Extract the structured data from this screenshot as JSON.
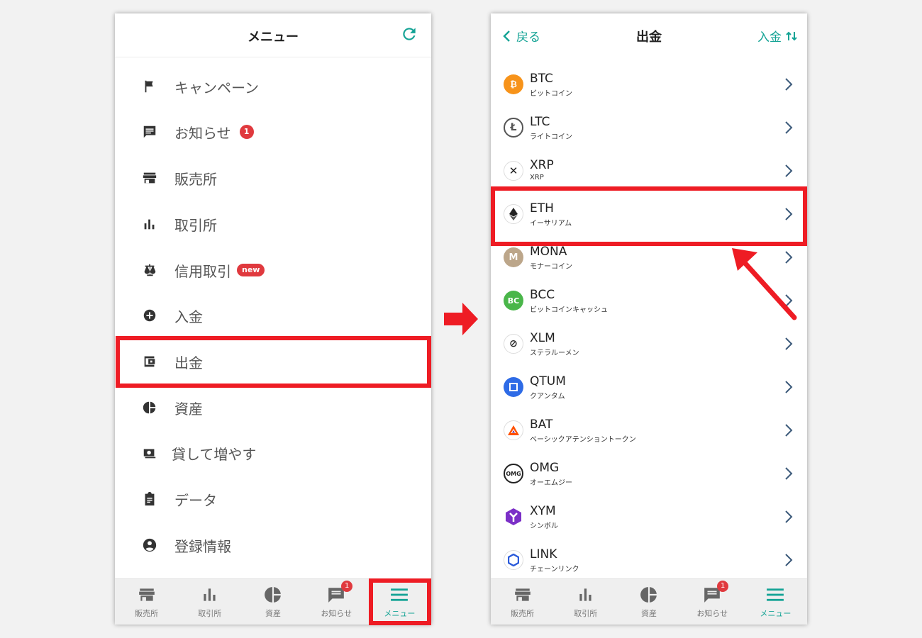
{
  "left": {
    "title": "メニュー",
    "refresh_icon": "refresh-icon",
    "items": [
      {
        "icon": "flag-icon",
        "label": "キャンペーン"
      },
      {
        "icon": "message-icon",
        "label": "お知らせ",
        "badge": "1"
      },
      {
        "icon": "store-icon",
        "label": "販売所"
      },
      {
        "icon": "bar-chart-icon",
        "label": "取引所"
      },
      {
        "icon": "scale-icon",
        "label": "信用取引",
        "tag": "new"
      },
      {
        "icon": "plus-circle-icon",
        "label": "入金"
      },
      {
        "icon": "wallet-icon",
        "label": "出金"
      },
      {
        "icon": "pie-chart-icon",
        "label": "資産"
      },
      {
        "icon": "money-icon",
        "label": "貸して増やす"
      },
      {
        "icon": "clipboard-icon",
        "label": "データ"
      },
      {
        "icon": "account-icon",
        "label": "登録情報"
      }
    ]
  },
  "tabs": [
    {
      "icon": "store-icon",
      "label": "販売所"
    },
    {
      "icon": "bar-chart-icon",
      "label": "取引所"
    },
    {
      "icon": "pie-chart-icon",
      "label": "資産"
    },
    {
      "icon": "message-icon",
      "label": "お知らせ",
      "badge": "1"
    },
    {
      "icon": "menu-icon",
      "label": "メニュー"
    }
  ],
  "right": {
    "back_label": "戻る",
    "title": "出金",
    "deposit_label": "入金",
    "coins": [
      {
        "symbol": "BTC",
        "name": "ビットコイン",
        "color": "#f7931a"
      },
      {
        "symbol": "LTC",
        "name": "ライトコイン",
        "color": "#ffffff"
      },
      {
        "symbol": "XRP",
        "name": "XRP",
        "color": "#ffffff"
      },
      {
        "symbol": "ETH",
        "name": "イーサリアム",
        "color": "#ffffff"
      },
      {
        "symbol": "MONA",
        "name": "モナーコイン",
        "color": "#bca68a"
      },
      {
        "symbol": "BCC",
        "name": "ビットコインキャッシュ",
        "color": "#4ab64a"
      },
      {
        "symbol": "XLM",
        "name": "ステラルーメン",
        "color": "#ffffff"
      },
      {
        "symbol": "QTUM",
        "name": "クアンタム",
        "color": "#2e6be6"
      },
      {
        "symbol": "BAT",
        "name": "ベーシックアテンショントークン",
        "color": "#ffffff"
      },
      {
        "symbol": "OMG",
        "name": "オーエムジー",
        "color": "#ffffff"
      },
      {
        "symbol": "XYM",
        "name": "シンボル",
        "color": "#7b2fc7"
      },
      {
        "symbol": "LINK",
        "name": "チェーンリンク",
        "color": "#ffffff"
      }
    ]
  },
  "colors": {
    "accent": "#14a395",
    "highlight": "#ee1c24",
    "badge": "#e0393e"
  }
}
